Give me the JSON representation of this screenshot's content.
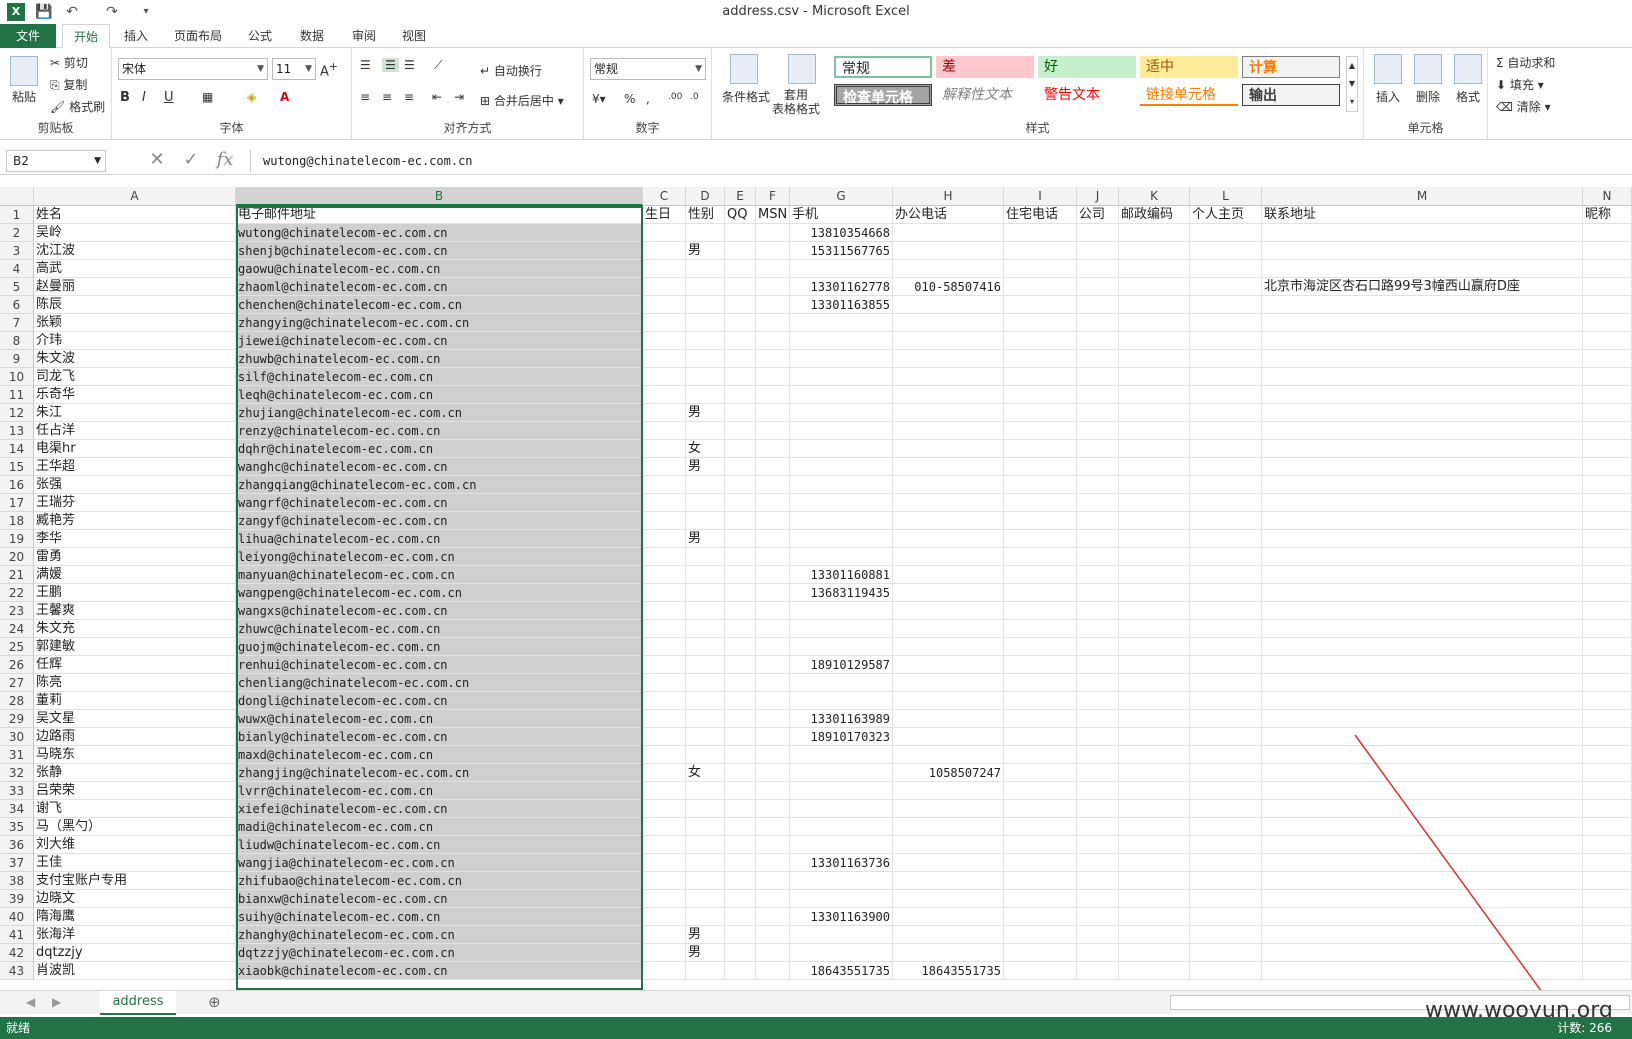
{
  "window": {
    "title": "address.csv - Microsoft Excel"
  },
  "quick_access": {
    "save_icon": "save-icon",
    "undo_icon": "undo-icon",
    "redo_icon": "redo-icon"
  },
  "tabs": [
    "文件",
    "开始",
    "插入",
    "页面布局",
    "公式",
    "数据",
    "审阅",
    "视图"
  ],
  "active_tab": "开始",
  "ribbon": {
    "clipboard": {
      "paste": "粘贴",
      "cut": "剪切",
      "copy": "复制",
      "format_painter": "格式刷",
      "label": "剪贴板"
    },
    "font": {
      "name": "宋体",
      "size": "11",
      "label": "字体"
    },
    "alignment": {
      "wrap": "自动换行",
      "merge": "合并后居中",
      "label": "对齐方式"
    },
    "number": {
      "format": "常规",
      "label": "数字"
    },
    "styles": {
      "conditional": "条件格式",
      "table": "套用\n表格格式",
      "cells": [
        {
          "text": "常规"
        },
        {
          "text": "差"
        },
        {
          "text": "好"
        },
        {
          "text": "适中"
        },
        {
          "text": "计算"
        },
        {
          "text": "检查单元格"
        },
        {
          "text": "解释性文本"
        },
        {
          "text": "警告文本"
        },
        {
          "text": "链接单元格"
        },
        {
          "text": "输出"
        }
      ],
      "label": "样式"
    },
    "cells_group": {
      "insert": "插入",
      "delete": "删除",
      "format": "格式",
      "label": "单元格"
    },
    "editing": {
      "autosum": "自动求和",
      "fill": "填充",
      "clear": "清除"
    }
  },
  "formula_bar": {
    "name_box": "B2",
    "content": "wutong@chinatelecom-ec.com.cn"
  },
  "columns": [
    "A",
    "B",
    "C",
    "D",
    "E",
    "F",
    "G",
    "H",
    "I",
    "J",
    "K",
    "L",
    "M",
    "N"
  ],
  "header_row": [
    "姓名",
    "电子邮件地址",
    "生日",
    "性别",
    "QQ",
    "MSN",
    "手机",
    "办公电话",
    "住宅电话",
    "公司",
    "邮政编码",
    "个人主页",
    "联系地址",
    "昵称"
  ],
  "rows": [
    {
      "n": "2",
      "name": "吴岭",
      "email": "wutong@chinatelecom-ec.com.cn",
      "sex": "",
      "mobile": "13810354668",
      "office": "",
      "addr": ""
    },
    {
      "n": "3",
      "name": "沈江波",
      "email": "shenjb@chinatelecom-ec.com.cn",
      "sex": "男",
      "mobile": "15311567765",
      "office": "",
      "addr": ""
    },
    {
      "n": "4",
      "name": "高武",
      "email": "gaowu@chinatelecom-ec.com.cn",
      "sex": "",
      "mobile": "",
      "office": "",
      "addr": ""
    },
    {
      "n": "5",
      "name": "赵曼丽",
      "email": "zhaoml@chinatelecom-ec.com.cn",
      "sex": "",
      "mobile": "13301162778",
      "office": "010-58507416",
      "addr": "北京市海淀区杏石口路99号3幢西山赢府D座"
    },
    {
      "n": "6",
      "name": "陈辰",
      "email": "chenchen@chinatelecom-ec.com.cn",
      "sex": "",
      "mobile": "13301163855",
      "office": "",
      "addr": ""
    },
    {
      "n": "7",
      "name": "张颖",
      "email": "zhangying@chinatelecom-ec.com.cn",
      "sex": "",
      "mobile": "",
      "office": "",
      "addr": ""
    },
    {
      "n": "8",
      "name": "介玮",
      "email": "jiewei@chinatelecom-ec.com.cn",
      "sex": "",
      "mobile": "",
      "office": "",
      "addr": ""
    },
    {
      "n": "9",
      "name": "朱文波",
      "email": "zhuwb@chinatelecom-ec.com.cn",
      "sex": "",
      "mobile": "",
      "office": "",
      "addr": ""
    },
    {
      "n": "10",
      "name": "司龙飞",
      "email": "silf@chinatelecom-ec.com.cn",
      "sex": "",
      "mobile": "",
      "office": "",
      "addr": ""
    },
    {
      "n": "11",
      "name": "乐奇华",
      "email": "leqh@chinatelecom-ec.com.cn",
      "sex": "",
      "mobile": "",
      "office": "",
      "addr": ""
    },
    {
      "n": "12",
      "name": "朱江",
      "email": "zhujiang@chinatelecom-ec.com.cn",
      "sex": "男",
      "mobile": "",
      "office": "",
      "addr": ""
    },
    {
      "n": "13",
      "name": "任占洋",
      "email": "renzy@chinatelecom-ec.com.cn",
      "sex": "",
      "mobile": "",
      "office": "",
      "addr": ""
    },
    {
      "n": "14",
      "name": "电渠hr",
      "email": "dqhr@chinatelecom-ec.com.cn",
      "sex": "女",
      "mobile": "",
      "office": "",
      "addr": ""
    },
    {
      "n": "15",
      "name": "王华超",
      "email": "wanghc@chinatelecom-ec.com.cn",
      "sex": "男",
      "mobile": "",
      "office": "",
      "addr": ""
    },
    {
      "n": "16",
      "name": "张强",
      "email": "zhangqiang@chinatelecom-ec.com.cn",
      "sex": "",
      "mobile": "",
      "office": "",
      "addr": ""
    },
    {
      "n": "17",
      "name": "王瑞芬",
      "email": "wangrf@chinatelecom-ec.com.cn",
      "sex": "",
      "mobile": "",
      "office": "",
      "addr": ""
    },
    {
      "n": "18",
      "name": "臧艳芳",
      "email": "zangyf@chinatelecom-ec.com.cn",
      "sex": "",
      "mobile": "",
      "office": "",
      "addr": ""
    },
    {
      "n": "19",
      "name": "李华",
      "email": "lihua@chinatelecom-ec.com.cn",
      "sex": "男",
      "mobile": "",
      "office": "",
      "addr": ""
    },
    {
      "n": "20",
      "name": "雷勇",
      "email": "leiyong@chinatelecom-ec.com.cn",
      "sex": "",
      "mobile": "",
      "office": "",
      "addr": ""
    },
    {
      "n": "21",
      "name": "满媛",
      "email": "manyuan@chinatelecom-ec.com.cn",
      "sex": "",
      "mobile": "13301160881",
      "office": "",
      "addr": ""
    },
    {
      "n": "22",
      "name": "王鹏",
      "email": "wangpeng@chinatelecom-ec.com.cn",
      "sex": "",
      "mobile": "13683119435",
      "office": "",
      "addr": ""
    },
    {
      "n": "23",
      "name": "王馨爽",
      "email": "wangxs@chinatelecom-ec.com.cn",
      "sex": "",
      "mobile": "",
      "office": "",
      "addr": ""
    },
    {
      "n": "24",
      "name": "朱文充",
      "email": "zhuwc@chinatelecom-ec.com.cn",
      "sex": "",
      "mobile": "",
      "office": "",
      "addr": ""
    },
    {
      "n": "25",
      "name": "郭建敏",
      "email": "guojm@chinatelecom-ec.com.cn",
      "sex": "",
      "mobile": "",
      "office": "",
      "addr": ""
    },
    {
      "n": "26",
      "name": "任辉",
      "email": "renhui@chinatelecom-ec.com.cn",
      "sex": "",
      "mobile": "18910129587",
      "office": "",
      "addr": ""
    },
    {
      "n": "27",
      "name": "陈亮",
      "email": "chenliang@chinatelecom-ec.com.cn",
      "sex": "",
      "mobile": "",
      "office": "",
      "addr": ""
    },
    {
      "n": "28",
      "name": "董莉",
      "email": "dongli@chinatelecom-ec.com.cn",
      "sex": "",
      "mobile": "",
      "office": "",
      "addr": ""
    },
    {
      "n": "29",
      "name": "吴文星",
      "email": "wuwx@chinatelecom-ec.com.cn",
      "sex": "",
      "mobile": "13301163989",
      "office": "",
      "addr": ""
    },
    {
      "n": "30",
      "name": "边路雨",
      "email": "bianly@chinatelecom-ec.com.cn",
      "sex": "",
      "mobile": "18910170323",
      "office": "",
      "addr": ""
    },
    {
      "n": "31",
      "name": "马晓东",
      "email": "maxd@chinatelecom-ec.com.cn",
      "sex": "",
      "mobile": "",
      "office": "",
      "addr": ""
    },
    {
      "n": "32",
      "name": "张静",
      "email": "zhangjing@chinatelecom-ec.com.cn",
      "sex": "女",
      "mobile": "",
      "office": "1058507247",
      "addr": ""
    },
    {
      "n": "33",
      "name": "吕荣荣",
      "email": "lvrr@chinatelecom-ec.com.cn",
      "sex": "",
      "mobile": "",
      "office": "",
      "addr": ""
    },
    {
      "n": "34",
      "name": "谢飞",
      "email": "xiefei@chinatelecom-ec.com.cn",
      "sex": "",
      "mobile": "",
      "office": "",
      "addr": ""
    },
    {
      "n": "35",
      "name": "马（黑勺）",
      "email": "madi@chinatelecom-ec.com.cn",
      "sex": "",
      "mobile": "",
      "office": "",
      "addr": ""
    },
    {
      "n": "36",
      "name": "刘大维",
      "email": "liudw@chinatelecom-ec.com.cn",
      "sex": "",
      "mobile": "",
      "office": "",
      "addr": ""
    },
    {
      "n": "37",
      "name": "王佳",
      "email": "wangjia@chinatelecom-ec.com.cn",
      "sex": "",
      "mobile": "13301163736",
      "office": "",
      "addr": ""
    },
    {
      "n": "38",
      "name": "支付宝账户专用",
      "email": "zhifubao@chinatelecom-ec.com.cn",
      "sex": "",
      "mobile": "",
      "office": "",
      "addr": ""
    },
    {
      "n": "39",
      "name": "边晓文",
      "email": "bianxw@chinatelecom-ec.com.cn",
      "sex": "",
      "mobile": "",
      "office": "",
      "addr": ""
    },
    {
      "n": "40",
      "name": "隋海鹰",
      "email": "suihy@chinatelecom-ec.com.cn",
      "sex": "",
      "mobile": "13301163900",
      "office": "",
      "addr": ""
    },
    {
      "n": "41",
      "name": "张海洋",
      "email": "zhanghy@chinatelecom-ec.com.cn",
      "sex": "男",
      "mobile": "",
      "office": "",
      "addr": ""
    },
    {
      "n": "42",
      "name": "dqtzzjy",
      "email": "dqtzzjy@chinatelecom-ec.com.cn",
      "sex": "男",
      "mobile": "",
      "office": "",
      "addr": ""
    },
    {
      "n": "43",
      "name": "肖波凯",
      "email": "xiaobk@chinatelecom-ec.com.cn",
      "sex": "",
      "mobile": "18643551735",
      "office": "18643551735",
      "addr": ""
    }
  ],
  "sheet_tab": "address",
  "status": {
    "left": "就绪",
    "right": "计数: 266"
  },
  "watermark": "www.wooyun.org",
  "colors": {
    "accent": "#217346",
    "selection_fill": "#cfcfcf",
    "arrow": "#e03030"
  }
}
